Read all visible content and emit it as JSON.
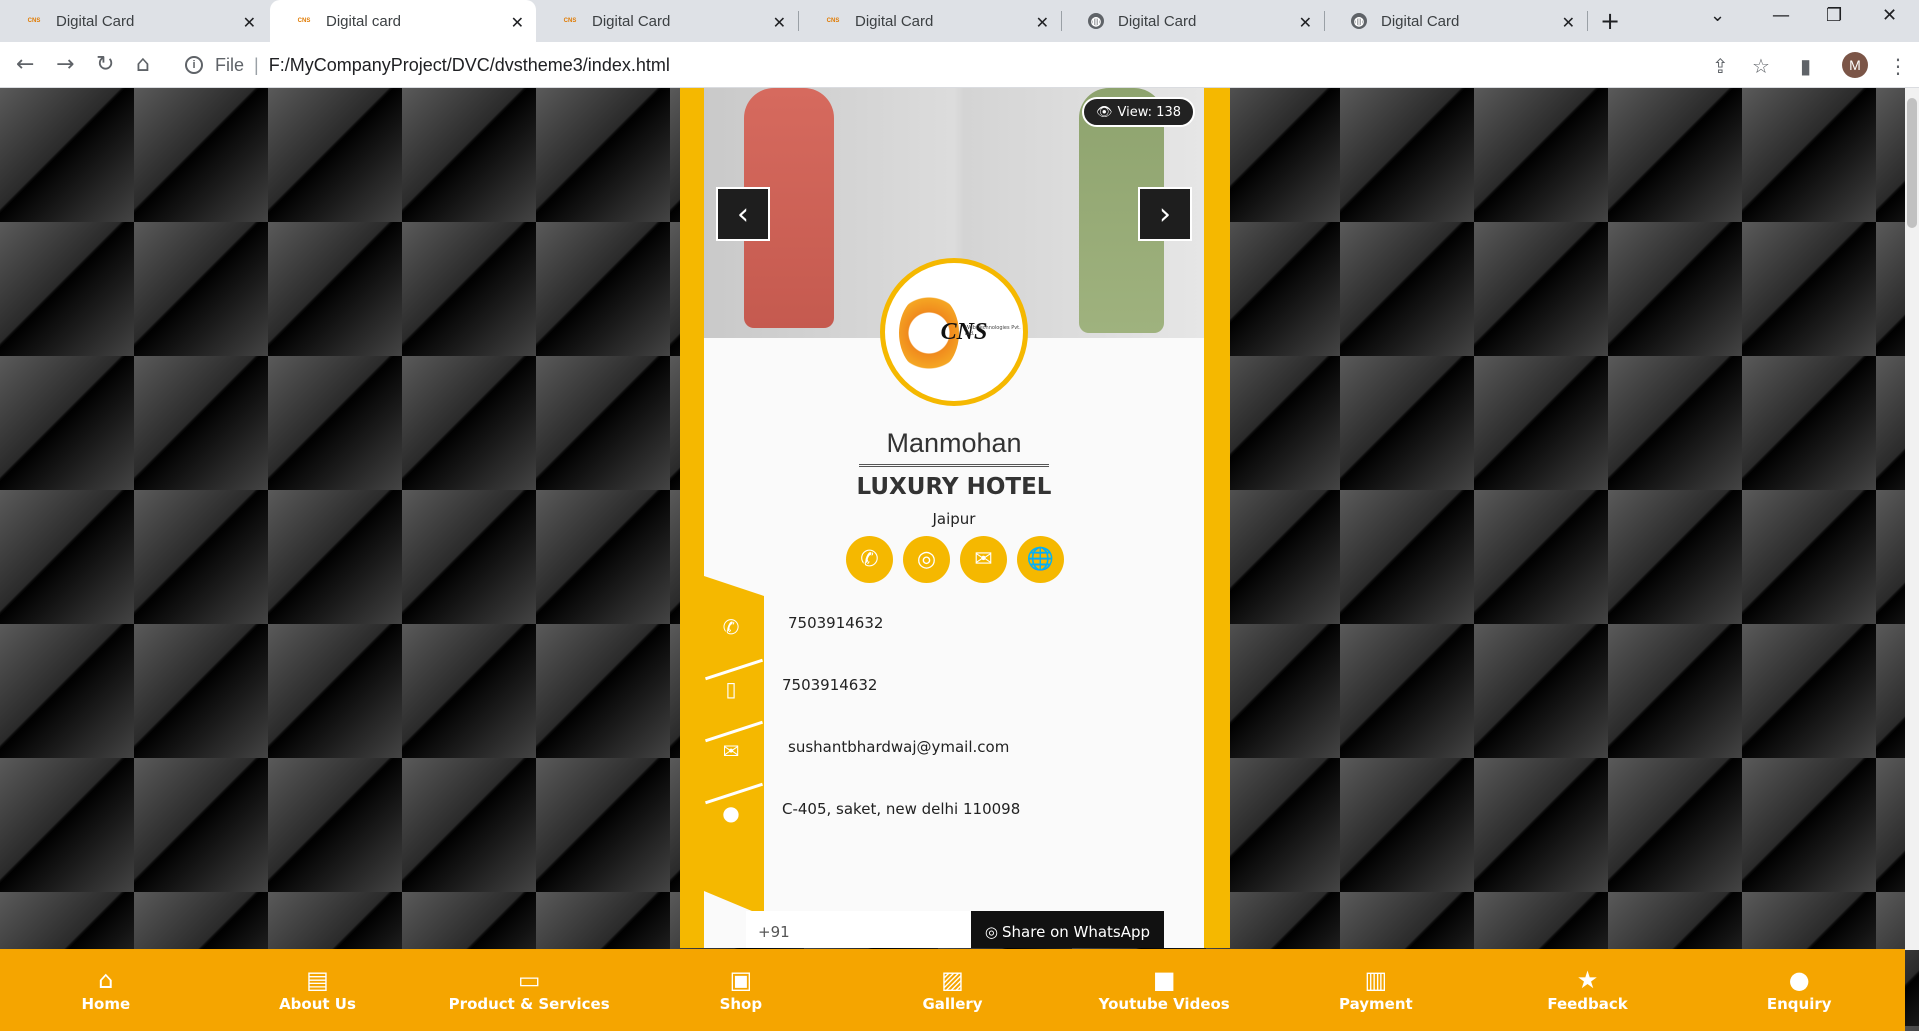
{
  "browser": {
    "tabs": [
      {
        "title": "Digital Card",
        "favicon": "cns-favicon"
      },
      {
        "title": "Digital card",
        "favicon": "cns-favicon",
        "active": true
      },
      {
        "title": "Digital Card",
        "favicon": "cns-favicon"
      },
      {
        "title": "Digital Card",
        "favicon": "cns-favicon"
      },
      {
        "title": "Digital Card",
        "favicon": "globe-icon"
      },
      {
        "title": "Digital Card",
        "favicon": "globe-icon"
      }
    ],
    "url_scheme": "File",
    "url": "F:/MyCompanyProject/DVC/dvstheme3/index.html",
    "profile_initial": "M"
  },
  "card": {
    "view_count": "View: 138",
    "logo_text": "CNS",
    "logo_subtext": "Web Technologies Pvt. Ltd.",
    "name": "Manmohan",
    "company": "LUXURY HOTEL",
    "city": "Jaipur",
    "contacts": {
      "phone": "7503914632",
      "mobile": "7503914632",
      "email": "sushantbhardwaj@ymail.com",
      "address": "C-405, saket, new delhi 110098"
    },
    "share": {
      "input_value": "+91",
      "button_label": "Share on WhatsApp"
    }
  },
  "bottom_nav": [
    {
      "label": "Home",
      "icon": "home-icon"
    },
    {
      "label": "About Us",
      "icon": "briefcase-icon"
    },
    {
      "label": "Product & Services",
      "icon": "products-icon"
    },
    {
      "label": "Shop",
      "icon": "shop-icon"
    },
    {
      "label": "Gallery",
      "icon": "gallery-icon"
    },
    {
      "label": "Youtube Videos",
      "icon": "video-icon"
    },
    {
      "label": "Payment",
      "icon": "money-icon"
    },
    {
      "label": "Feedback",
      "icon": "star-icon"
    },
    {
      "label": "Enquiry",
      "icon": "chat-icon"
    }
  ],
  "colors": {
    "accent": "#f5b800",
    "nav_bg": "#f5a500",
    "dark": "#1e1e1e"
  }
}
